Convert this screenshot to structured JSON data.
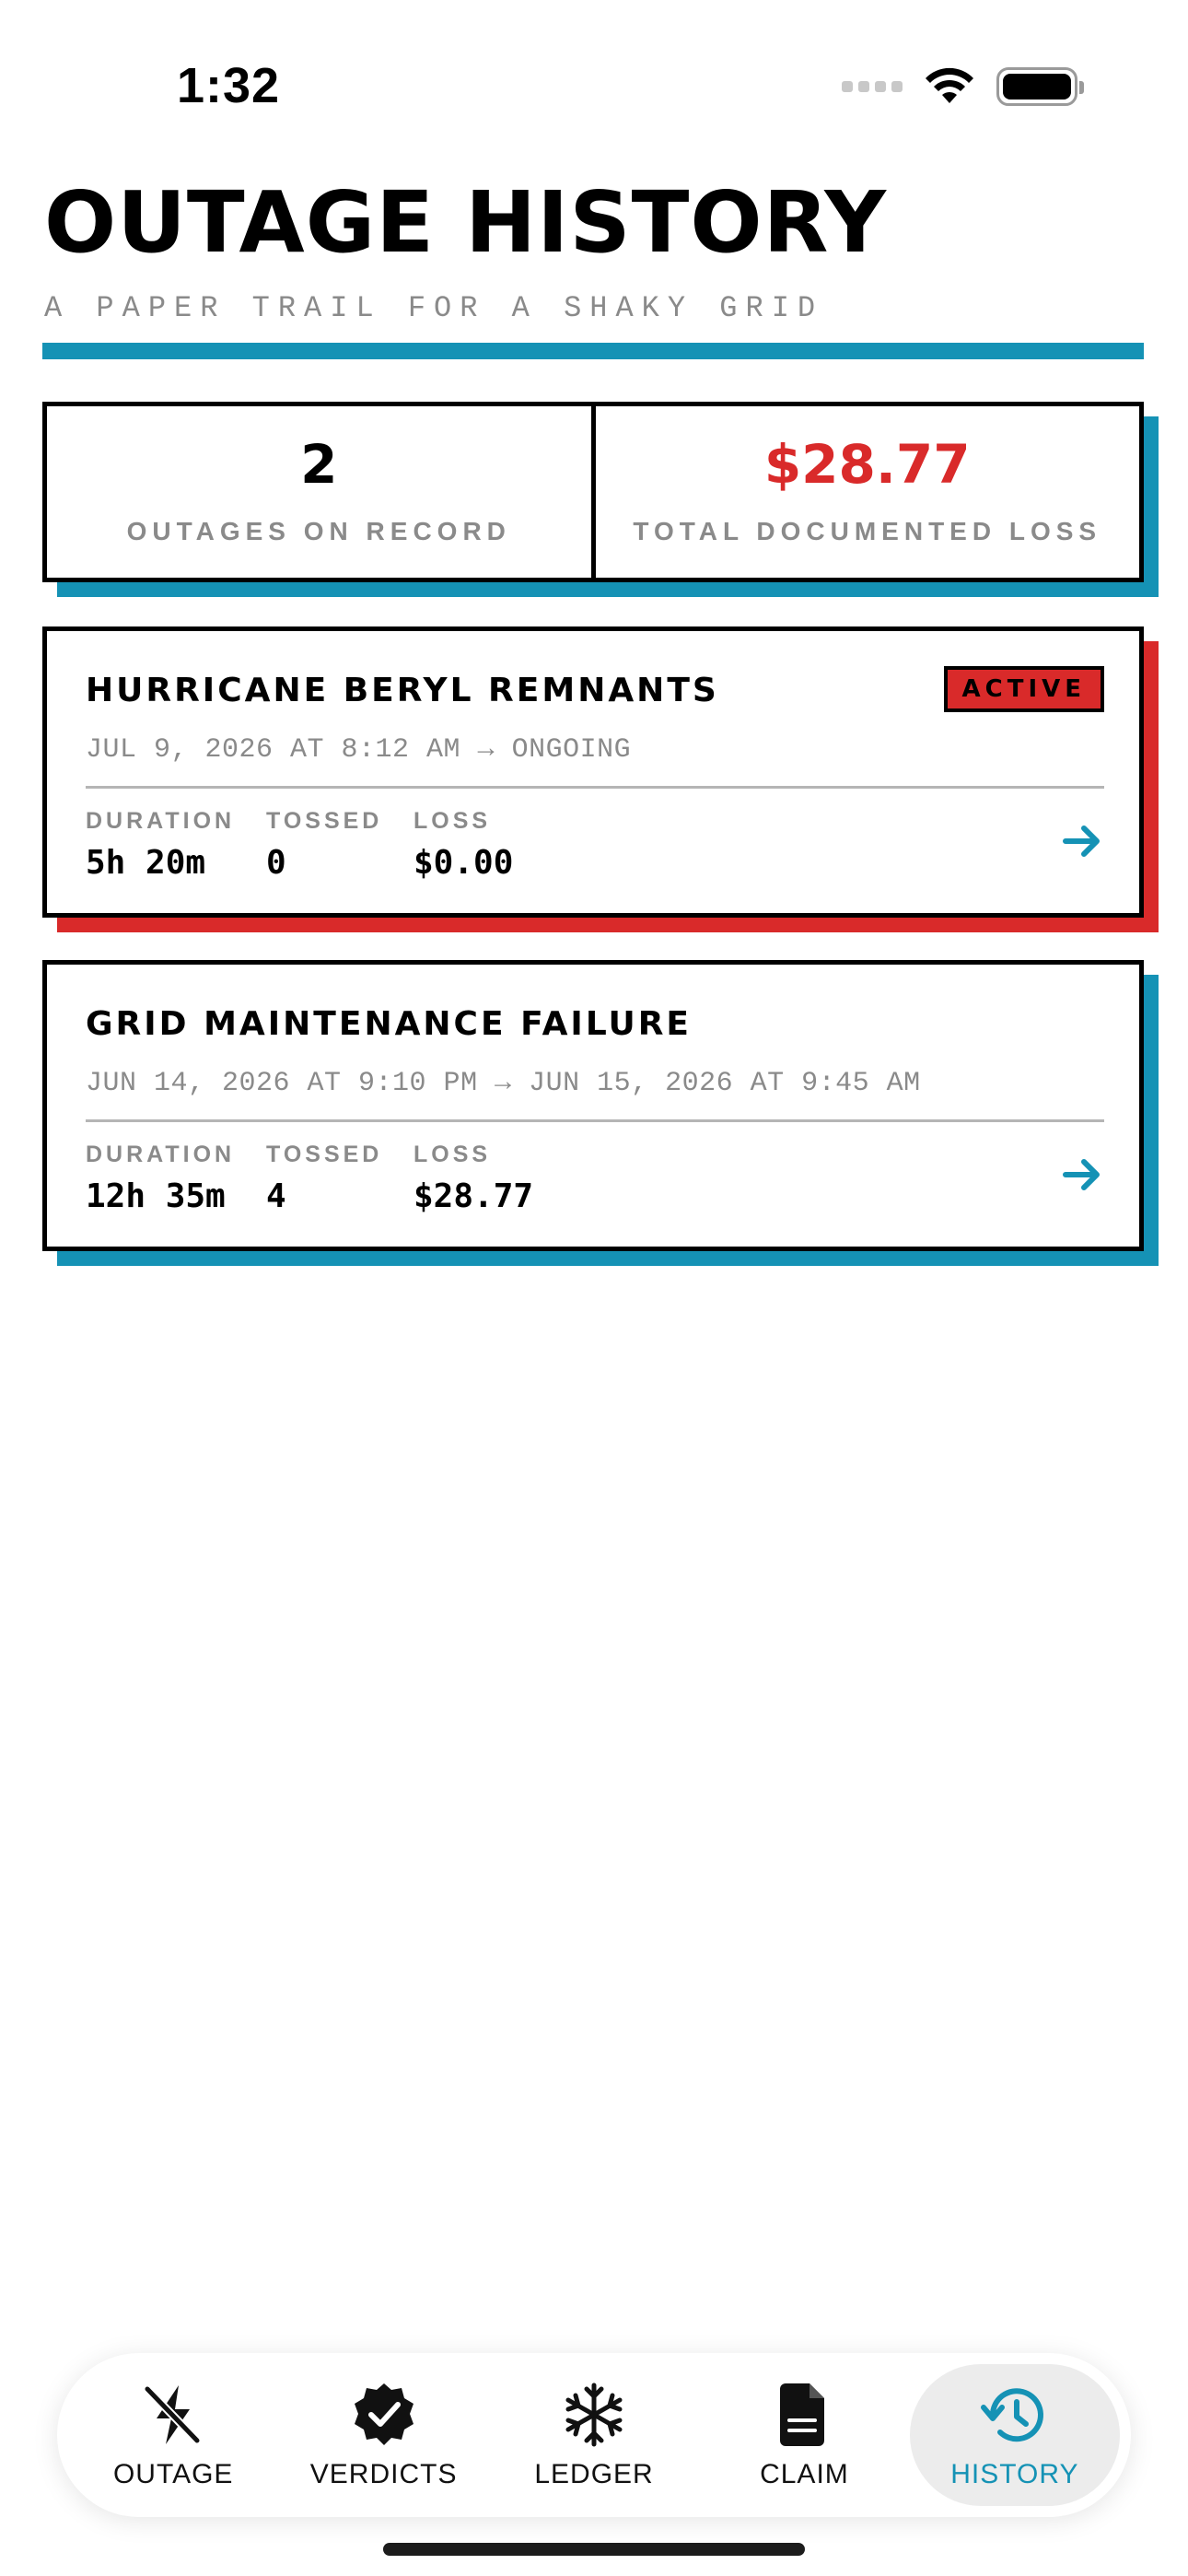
{
  "status_bar": {
    "time": "1:32"
  },
  "header": {
    "title": "OUTAGE HISTORY",
    "subtitle": "A PAPER TRAIL FOR A SHAKY GRID"
  },
  "stats": {
    "outages_value": "2",
    "outages_label": "OUTAGES ON RECORD",
    "loss_value": "$28.77",
    "loss_label": "TOTAL DOCUMENTED LOSS"
  },
  "outages": [
    {
      "title": "HURRICANE BERYL REMNANTS",
      "badge": "ACTIVE",
      "dates": "JUL 9, 2026 AT 8:12 AM → ONGOING",
      "duration_label": "DURATION",
      "duration": "5h 20m",
      "tossed_label": "TOSSED",
      "tossed": "0",
      "loss_label": "LOSS",
      "loss": "$0.00"
    },
    {
      "title": "GRID MAINTENANCE FAILURE",
      "dates": "JUN 14, 2026 AT 9:10 PM → JUN 15, 2026 AT 9:45 AM",
      "duration_label": "DURATION",
      "duration": "12h 35m",
      "tossed_label": "TOSSED",
      "tossed": "4",
      "loss_label": "LOSS",
      "loss": "$28.77"
    }
  ],
  "tabs": [
    {
      "label": "OUTAGE",
      "icon": "bolt-slash-icon"
    },
    {
      "label": "VERDICTS",
      "icon": "checkmark-seal-icon"
    },
    {
      "label": "LEDGER",
      "icon": "snowflake-icon"
    },
    {
      "label": "CLAIM",
      "icon": "document-icon"
    },
    {
      "label": "HISTORY",
      "icon": "history-clock-icon",
      "active": true
    }
  ],
  "colors": {
    "accent_blue": "#1592b5",
    "alert_red": "#d92a2a",
    "muted_text": "#8a8a8a"
  }
}
